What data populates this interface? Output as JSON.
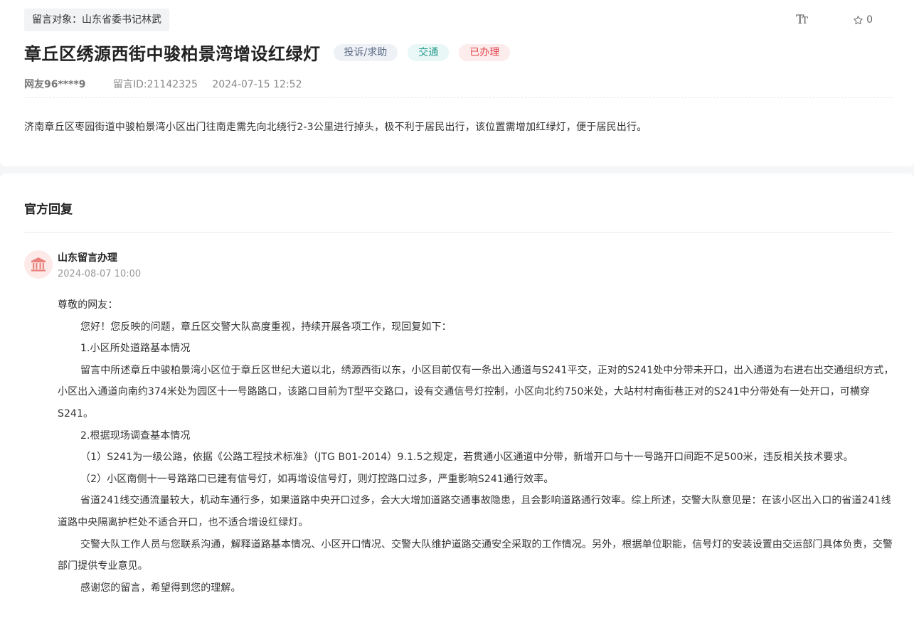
{
  "message": {
    "target_label": "留言对象：山东省委书记林武",
    "font_size_label": "TT",
    "favorite_count": "0",
    "title": "章丘区绣源西街中骏柏景湾增设红绿灯",
    "badges": {
      "type": "投诉/求助",
      "category": "交通",
      "status": "已办理"
    },
    "author": "网友96****9",
    "message_id": "留言ID:21142325",
    "datetime": "2024-07-15 12:52",
    "content": "济南章丘区枣园街道中骏柏景湾小区出门往南走需先向北绕行2-3公里进行掉头，极不利于居民出行，该位置需增加红绿灯，便于居民出行。"
  },
  "reply": {
    "section_title": "官方回复",
    "replier_name": "山东留言办理",
    "replier_time": "2024-08-07 10:00",
    "paragraphs": [
      "尊敬的网友：",
      "您好！您反映的问题，章丘区交警大队高度重视，持续开展各项工作，现回复如下：",
      "1.小区所处道路基本情况",
      "留言中所述章丘中骏柏景湾小区位于章丘区世纪大道以北，绣源西街以东，小区目前仅有一条出入通道与S241平交，正对的S241处中分带未开口，出入通道为右进右出交通组织方式，小区出入通道向南约374米处为园区十一号路路口，该路口目前为T型平交路口，设有交通信号灯控制，小区向北约750米处，大站村村南街巷正对的S241中分带处有一处开口，可横穿S241。",
      "2.根据现场调查基本情况",
      "（1）S241为一级公路，依据《公路工程技术标准》（JTG B01-2014）9.1.5之规定，若贯通小区通道中分带，新增开口与十一号路开口间距不足500米，违反相关技术要求。",
      "（2）小区南侧十一号路路口已建有信号灯，如再增设信号灯，则灯控路口过多，严重影响S241通行效率。",
      "省道241线交通流量较大，机动车通行多，如果道路中央开口过多，会大大增加道路交通事故隐患，且会影响道路通行效率。综上所述，交警大队意见是：在该小区出入口的省道241线道路中央隔离护栏处不适合开口，也不适合增设红绿灯。",
      "交警大队工作人员与您联系沟通，解释道路基本情况、小区开口情况、交警大队维护道路交通安全采取的工作情况。另外，根据单位职能，信号灯的安装设置由交运部门具体负责，交警部门提供专业意见。",
      "感谢您的留言，希望得到您的理解。"
    ]
  }
}
